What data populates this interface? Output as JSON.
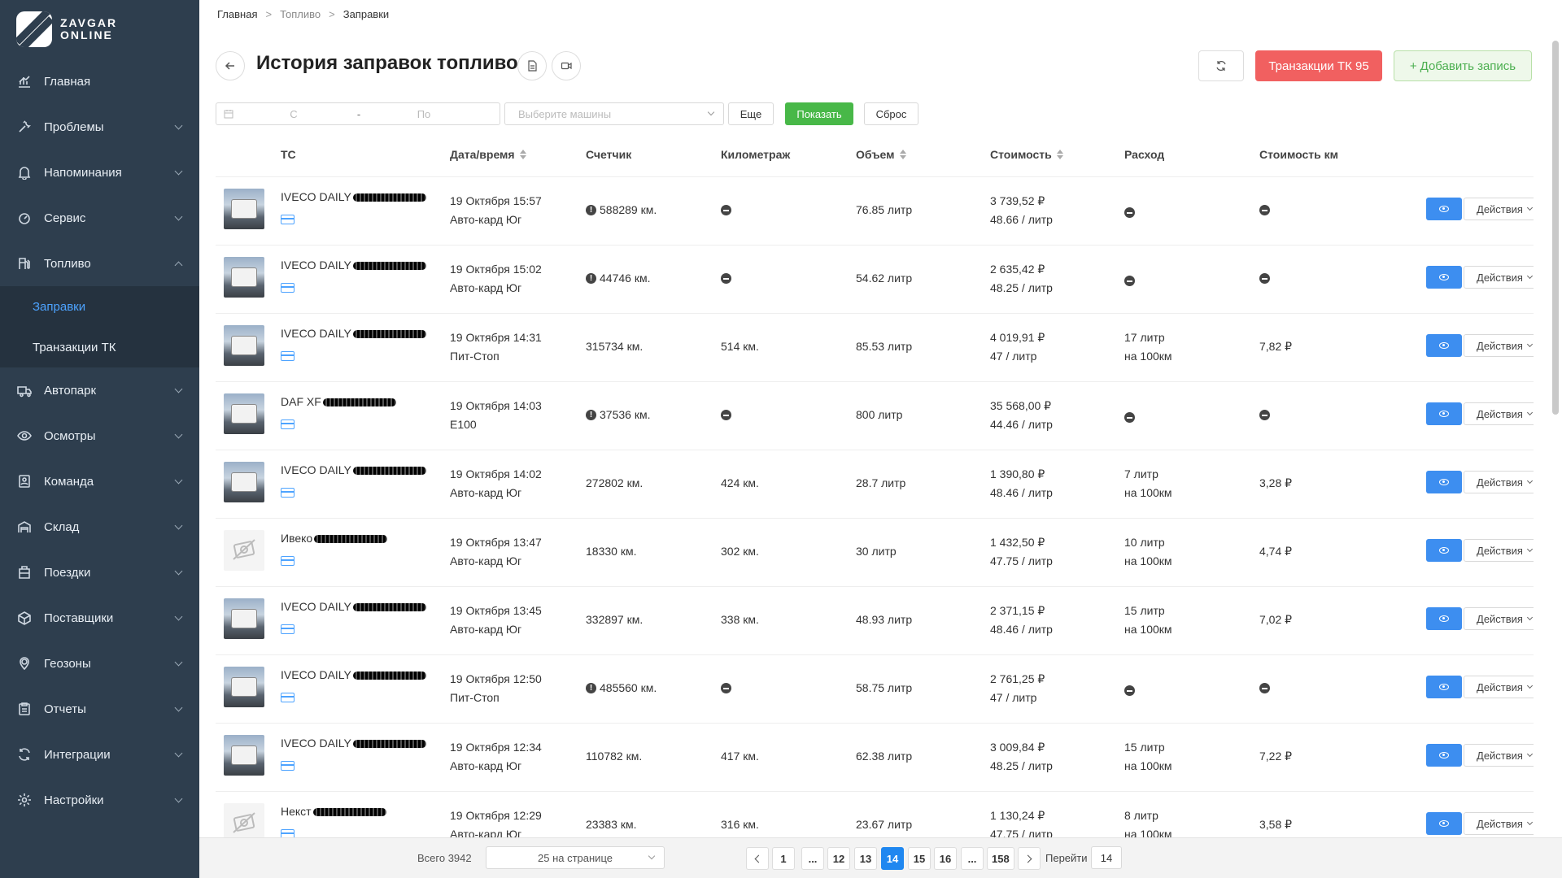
{
  "app": {
    "logo_line1": "ZAVGAR",
    "logo_line2": "ONLINE"
  },
  "sidebar": {
    "items": [
      {
        "label": "Главная",
        "icon": "dashboard-icon",
        "expandable": false
      },
      {
        "label": "Проблемы",
        "icon": "wrench-icon",
        "expandable": true
      },
      {
        "label": "Напоминания",
        "icon": "bell-icon",
        "expandable": true
      },
      {
        "label": "Сервис",
        "icon": "gauge-icon",
        "expandable": true
      },
      {
        "label": "Топливо",
        "icon": "fuel-pump-icon",
        "expandable": true,
        "open": true
      }
    ],
    "fuel_sub": [
      {
        "label": "Заправки",
        "active": true
      },
      {
        "label": "Транзакции ТК",
        "active": false
      }
    ],
    "items_after": [
      {
        "label": "Автопарк",
        "icon": "truck-icon"
      },
      {
        "label": "Осмотры",
        "icon": "eye-icon"
      },
      {
        "label": "Команда",
        "icon": "badge-icon"
      },
      {
        "label": "Склад",
        "icon": "warehouse-icon"
      },
      {
        "label": "Поездки",
        "icon": "trips-icon"
      },
      {
        "label": "Поставщики",
        "icon": "box-icon"
      },
      {
        "label": "Геозоны",
        "icon": "pin-icon"
      },
      {
        "label": "Отчеты",
        "icon": "clipboard-icon"
      },
      {
        "label": "Интеграции",
        "icon": "sync-icon"
      },
      {
        "label": "Настройки",
        "icon": "gear-icon"
      }
    ]
  },
  "breadcrumb": {
    "home": "Главная",
    "section": "Топливо",
    "current": "Заправки",
    "sep": ">"
  },
  "header": {
    "title": "История заправок топливом",
    "tk_button": "Транзакции ТК 95",
    "add_button": "Добавить запись",
    "add_plus": "+"
  },
  "filters": {
    "from_placeholder": "С",
    "dash": "-",
    "to_placeholder": "По",
    "cars_placeholder": "Выберите машины",
    "more": "Еще",
    "show": "Показать",
    "reset": "Сброс"
  },
  "table": {
    "columns": {
      "vehicle": "ТС",
      "datetime": "Дата/время",
      "counter": "Счетчик",
      "mileage": "Километраж",
      "volume": "Объем",
      "cost": "Стоимость",
      "consumption": "Расход",
      "cost_km": "Стоимость км"
    },
    "view_label": "",
    "actions_label": "Действия",
    "rows": [
      {
        "vehicle": "IVECO DAILY",
        "photo": "truck",
        "date": "19 Октября 15:57",
        "station": "Авто-кард Юг",
        "counter": "588289 км.",
        "counter_warn": true,
        "mileage": "",
        "volume": "76.85 литр",
        "cost": "3 739,52 ₽",
        "price": "48.66 / литр",
        "rate": "",
        "rate2": "",
        "cost_km": ""
      },
      {
        "vehicle": "IVECO DAILY",
        "photo": "truck",
        "date": "19 Октября 15:02",
        "station": "Авто-кард Юг",
        "counter": "44746 км.",
        "counter_warn": true,
        "mileage": "",
        "volume": "54.62 литр",
        "cost": "2 635,42 ₽",
        "price": "48.25 / литр",
        "rate": "",
        "rate2": "",
        "cost_km": ""
      },
      {
        "vehicle": "IVECO DAILY",
        "photo": "truck",
        "date": "19 Октября 14:31",
        "station": "Пит-Стоп",
        "counter": "315734 км.",
        "counter_warn": false,
        "mileage": "514 км.",
        "volume": "85.53 литр",
        "cost": "4 019,91 ₽",
        "price": "47 / литр",
        "rate": "17 литр",
        "rate2": "на 100км",
        "cost_km": "7,82 ₽"
      },
      {
        "vehicle": "DAF XF",
        "photo": "truck",
        "date": "19 Октября 14:03",
        "station": "E100",
        "counter": "37536 км.",
        "counter_warn": true,
        "mileage": "",
        "volume": "800 литр",
        "cost": "35 568,00 ₽",
        "price": "44.46 / литр",
        "rate": "",
        "rate2": "",
        "cost_km": ""
      },
      {
        "vehicle": "IVECO DAILY",
        "photo": "truck",
        "date": "19 Октября 14:02",
        "station": "Авто-кард Юг",
        "counter": "272802 км.",
        "counter_warn": false,
        "mileage": "424 км.",
        "volume": "28.7 литр",
        "cost": "1 390,80 ₽",
        "price": "48.46 / литр",
        "rate": "7 литр",
        "rate2": "на 100км",
        "cost_km": "3,28 ₽"
      },
      {
        "vehicle": "Ивеко",
        "photo": "placeholder",
        "date": "19 Октября 13:47",
        "station": "Авто-кард Юг",
        "counter": "18330 км.",
        "counter_warn": false,
        "mileage": "302 км.",
        "volume": "30 литр",
        "cost": "1 432,50 ₽",
        "price": "47.75 / литр",
        "rate": "10 литр",
        "rate2": "на 100км",
        "cost_km": "4,74 ₽"
      },
      {
        "vehicle": "IVECO DAILY",
        "photo": "truck",
        "date": "19 Октября 13:45",
        "station": "Авто-кард Юг",
        "counter": "332897 км.",
        "counter_warn": false,
        "mileage": "338 км.",
        "volume": "48.93 литр",
        "cost": "2 371,15 ₽",
        "price": "48.46 / литр",
        "rate": "15 литр",
        "rate2": "на 100км",
        "cost_km": "7,02 ₽"
      },
      {
        "vehicle": "IVECO DAILY",
        "photo": "truck",
        "date": "19 Октября 12:50",
        "station": "Пит-Стоп",
        "counter": "485560 км.",
        "counter_warn": true,
        "mileage": "",
        "volume": "58.75 литр",
        "cost": "2 761,25 ₽",
        "price": "47 / литр",
        "rate": "",
        "rate2": "",
        "cost_km": ""
      },
      {
        "vehicle": "IVECO DAILY",
        "photo": "truck",
        "date": "19 Октября 12:34",
        "station": "Авто-кард Юг",
        "counter": "110782 км.",
        "counter_warn": false,
        "mileage": "417 км.",
        "volume": "62.38 литр",
        "cost": "3 009,84 ₽",
        "price": "48.25 / литр",
        "rate": "15 литр",
        "rate2": "на 100км",
        "cost_km": "7,22 ₽"
      },
      {
        "vehicle": "Некст",
        "photo": "placeholder",
        "date": "19 Октября 12:29",
        "station": "Авто-кард Юг",
        "counter": "23383 км.",
        "counter_warn": false,
        "mileage": "316 км.",
        "volume": "23.67 литр",
        "cost": "1 130,24 ₽",
        "price": "47.75 / литр",
        "rate": "8 литр",
        "rate2": "на 100км",
        "cost_km": "3,58 ₽"
      }
    ]
  },
  "pagination": {
    "total": "Всего 3942",
    "per_page": "25 на странице",
    "pages": [
      "1",
      "...",
      "12",
      "13",
      "14",
      "15",
      "16",
      "...",
      "158"
    ],
    "current": "14",
    "goto_label": "Перейти",
    "goto_value": "14"
  },
  "colors": {
    "sidebar": "#2e3e4e",
    "accent": "#1f87f0",
    "danger": "#f16060",
    "success": "#48b848"
  }
}
